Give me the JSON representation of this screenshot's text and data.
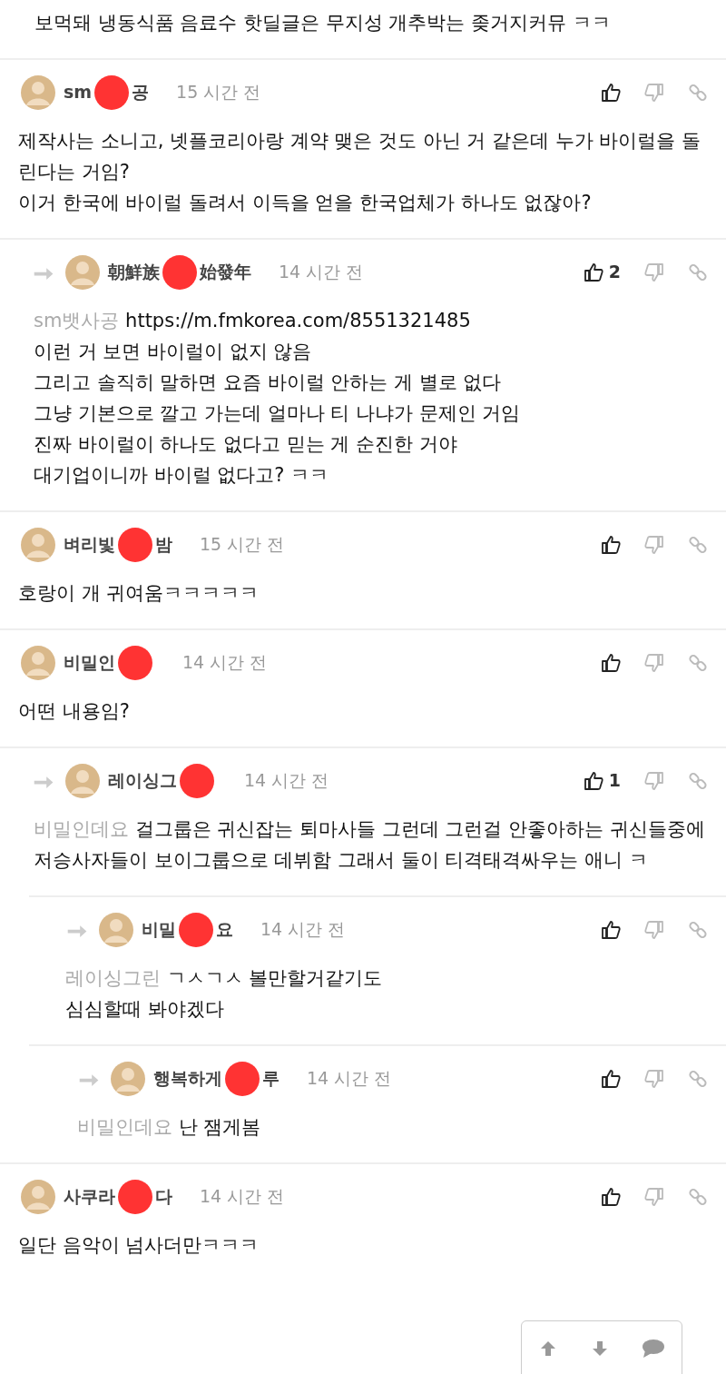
{
  "post_tail": "보먹돼 냉동식품 음료수 핫딜글은 무지성 개추박는 좆거지커뮤 ㅋㅋ",
  "comments": [
    {
      "author": {
        "start": "sm",
        "end": "공",
        "redacted": true
      },
      "time": "15 시간 전",
      "body": "제작사는 소니고, 넷플코리아랑 계약 맺은 것도 아닌 거 같은데 누가 바이럴을 돌린다는 거임?\n이거 한국에 바이럴 돌려서 이득을 얻을 한국업체가 하나도 없잖아?",
      "children": [
        {
          "author": {
            "start": "朝鮮族",
            "end": "始發年",
            "redacted": true
          },
          "time": "14 시간 전",
          "likes": "2",
          "mention": "sm뱃사공",
          "body": "https://m.fmkorea.com/8551321485\n이런 거 보면 바이럴이 없지 않음\n그리고 솔직히 말하면 요즘 바이럴 안하는 게 별로 없다\n그냥 기본으로 깔고 가는데 얼마나 티 나냐가 문제인 거임\n진짜 바이럴이 하나도 없다고 믿는 게 순진한 거야\n대기업이니까 바이럴 없다고? ㅋㅋ"
        }
      ]
    },
    {
      "author": {
        "start": "벼리빛",
        "end": "밤",
        "redacted": true
      },
      "time": "15 시간 전",
      "body": "호랑이 개 귀여움ㅋㅋㅋㅋㅋ"
    },
    {
      "author": {
        "start": "비밀인",
        "redacted": true
      },
      "time": "14 시간 전",
      "body": "어떤 내용임?",
      "children": [
        {
          "author": {
            "start": "레이싱그",
            "redacted": true
          },
          "time": "14 시간 전",
          "likes": "1",
          "mention": "비밀인데요",
          "body": "걸그룹은 귀신잡는 퇴마사들 그런데 그런걸 안좋아하는 귀신들중에 저승사자들이 보이그룹으로 데뷔함 그래서 둘이 티격태격싸우는 애니 ㅋ",
          "children": [
            {
              "author": {
                "start": "비밀",
                "end": "요",
                "redacted": true
              },
              "time": "14 시간 전",
              "mention": "레이싱그린",
              "body": "ㄱㅅㄱㅅ 볼만할거같기도\n심심할때 봐야겠다",
              "children": [
                {
                  "author": {
                    "start": "행복하게",
                    "end": "루",
                    "redacted": true
                  },
                  "time": "14 시간 전",
                  "mention": "비밀인데요",
                  "body": "난 잼게봄"
                }
              ]
            }
          ]
        }
      ]
    },
    {
      "author": {
        "start": "사쿠라",
        "end": "다",
        "redacted": true
      },
      "time": "14 시간 전",
      "body": "일단 음악이 넘사더만ㅋㅋㅋ"
    }
  ]
}
